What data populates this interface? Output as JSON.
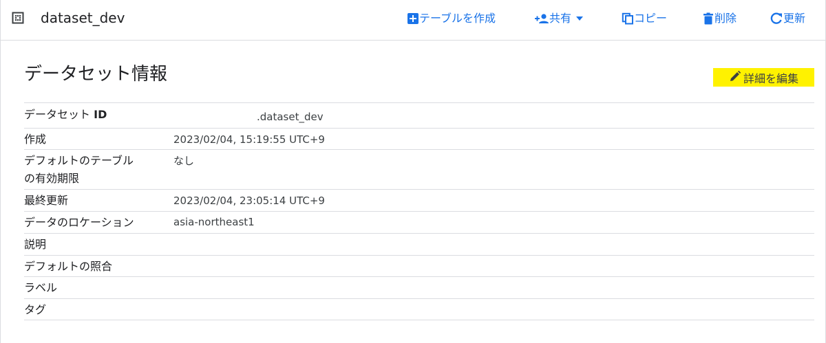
{
  "header": {
    "dataset_name": "dataset_dev",
    "actions": {
      "create_table": "テーブルを作成",
      "share": "共有",
      "copy": "コピー",
      "delete": "削除",
      "refresh": "更新"
    }
  },
  "section": {
    "title": "データセット情報",
    "edit_label": "詳細を編集"
  },
  "details": {
    "dataset_id": {
      "key_prefix": "データセット",
      "key_suffix": "ID",
      "value": ".dataset_dev"
    },
    "created": {
      "key": "作成",
      "value": "2023/02/04, 15:19:55 UTC+9"
    },
    "default_expiration": {
      "key_line1": "デフォルトのテーブル",
      "key_line2": "の有効期限",
      "value": "なし"
    },
    "last_modified": {
      "key": "最終更新",
      "value": "2023/02/04, 23:05:14 UTC+9"
    },
    "location": {
      "key": "データのロケーション",
      "value": "asia-northeast1"
    },
    "description": {
      "key": "説明",
      "value": ""
    },
    "collation": {
      "key": "デフォルトの照合",
      "value": ""
    },
    "labels": {
      "key": "ラベル",
      "value": ""
    },
    "tags": {
      "key": "タグ",
      "value": ""
    }
  },
  "colors": {
    "accent": "#1a73e8",
    "highlight": "#fff200",
    "divider": "#dadce0"
  },
  "icons": {
    "dataset": "dataset-grid-icon",
    "create_table": "add-box-icon",
    "share": "person-add-icon",
    "share_dropdown": "caret-down-icon",
    "copy": "copy-icon",
    "delete": "trash-icon",
    "refresh": "refresh-icon",
    "edit": "pencil-icon"
  }
}
